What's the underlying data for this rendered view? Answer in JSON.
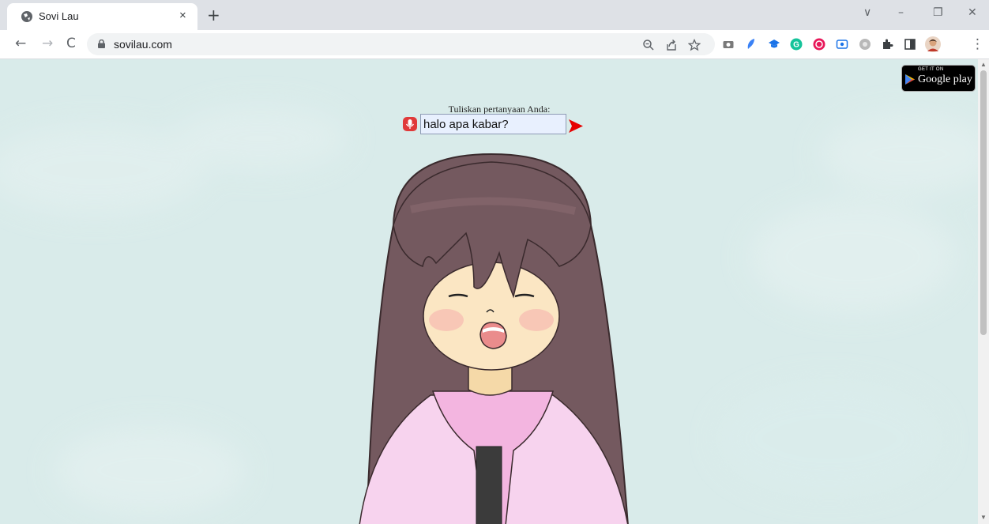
{
  "browser": {
    "tab_title": "Sovi Lau",
    "tab_close": "×",
    "new_tab": "+",
    "url": "sovilau.com",
    "window_controls": [
      "∨",
      "–",
      "❐",
      "✕"
    ]
  },
  "toolbar": {
    "back": "←",
    "forward": "→",
    "reload": "C",
    "menu": "⋮"
  },
  "page": {
    "background_color": "#d9ebea",
    "play_badge": {
      "get_it_on": "GET IT ON",
      "store": "Google play"
    },
    "prompt_label": "Tuliskan pertanyaan Anda:",
    "question_value": "halo apa kabar?",
    "character_name": "Sovi Lau"
  },
  "colors": {
    "hair": "#74595f",
    "skin": "#fbe6c3",
    "jacket": "#f6c3e6",
    "mic": "#e03a3a",
    "send": "#e60000"
  }
}
